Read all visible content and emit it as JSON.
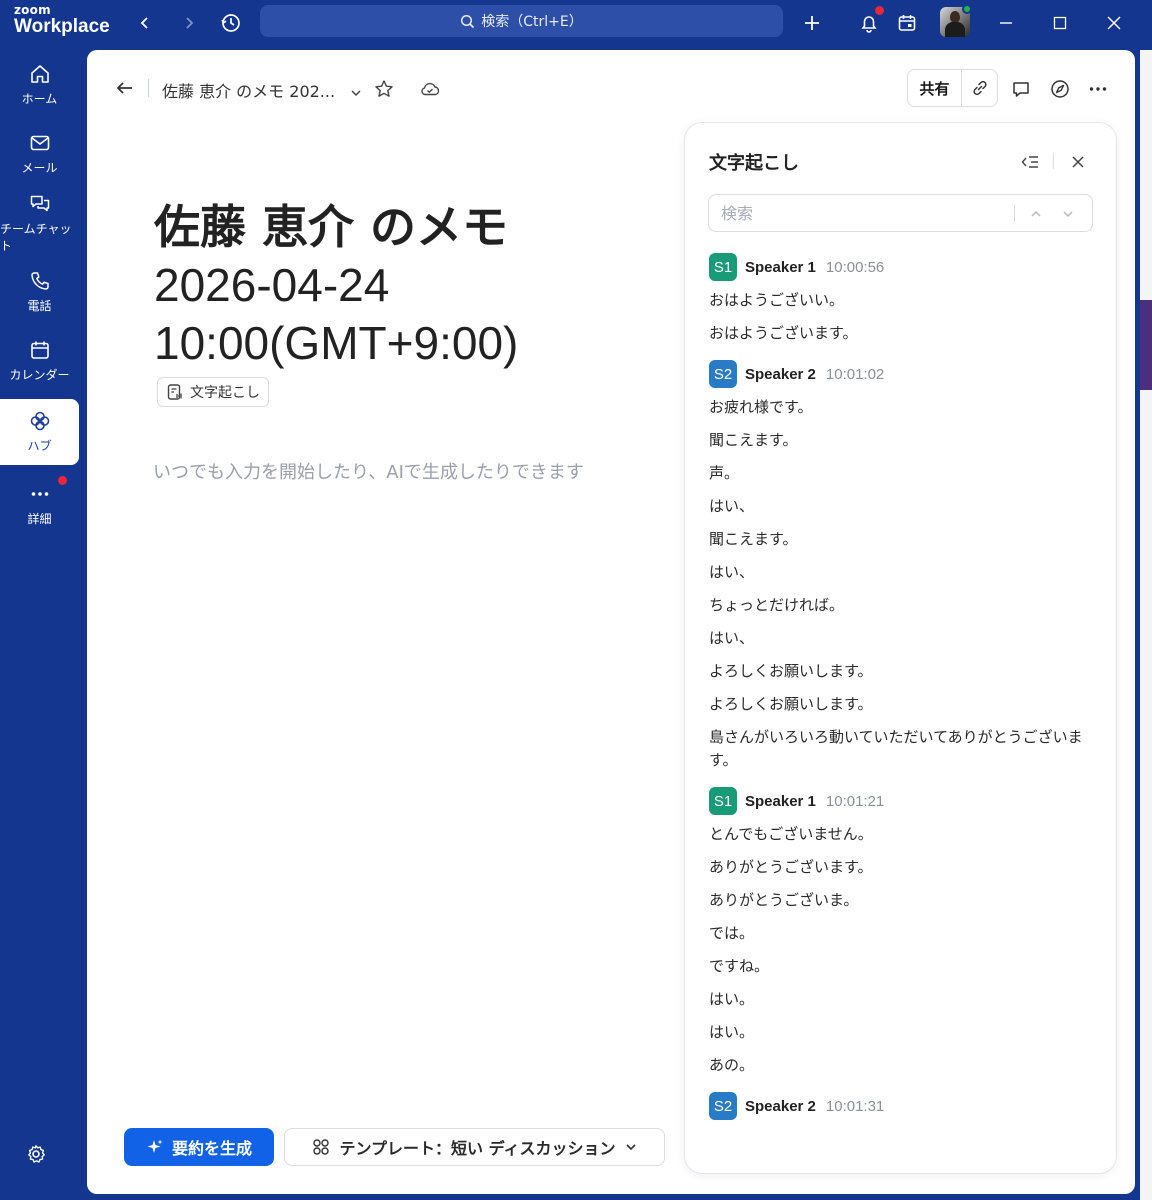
{
  "app": {
    "logo_small": "zoom",
    "logo_big": "Workplace",
    "search_placeholder": "検索（Ctrl+E）"
  },
  "colors": {
    "frame": "#14368f",
    "primary_button": "#1262e8",
    "speaker1": "#1a9b78",
    "speaker2": "#2a7bc6",
    "notification": "#e8273c",
    "online": "#22b14c"
  },
  "nav": {
    "items": [
      {
        "label": "ホーム",
        "icon": "home-icon"
      },
      {
        "label": "メール",
        "icon": "mail-icon"
      },
      {
        "label": "チームチャット",
        "icon": "chat-icon"
      },
      {
        "label": "電話",
        "icon": "phone-icon"
      },
      {
        "label": "カレンダー",
        "icon": "calendar-icon"
      },
      {
        "label": "ハブ",
        "icon": "hub-icon",
        "active": true
      },
      {
        "label": "詳細",
        "icon": "more-icon"
      }
    ]
  },
  "doc": {
    "breadcrumb_title": "佐藤 恵介 のメモ 202...",
    "share_label": "共有",
    "title_line1": "佐藤 恵介 のメモ",
    "title_line2": "2026-04-24",
    "title_line3": "10:00(GMT+9:00)",
    "chip_label": "文字起こし",
    "placeholder": "いつでも入力を開始したり、AIで生成したりできます",
    "generate_button": "要約を生成",
    "template_button": "テンプレート：短い ディスカッション"
  },
  "transcript": {
    "title": "文字起こし",
    "search_placeholder": "検索",
    "blocks": [
      {
        "badge": "S1",
        "speaker": "Speaker 1",
        "time": "10:00:56",
        "lines": [
          "おはようございい。",
          "おはようございます。"
        ]
      },
      {
        "badge": "S2",
        "speaker": "Speaker 2",
        "time": "10:01:02",
        "lines": [
          "お疲れ様です。",
          "聞こえます。",
          "声。",
          "はい、",
          "聞こえます。",
          "はい、",
          "ちょっとだければ。",
          "はい、",
          "よろしくお願いします。",
          "よろしくお願いします。",
          "島さんがいろいろ動いていただいてありがとうございます。"
        ]
      },
      {
        "badge": "S1",
        "speaker": "Speaker 1",
        "time": "10:01:21",
        "lines": [
          "とんでもございません。",
          "ありがとうございます。",
          "ありがとうございま。",
          "では。",
          "ですね。",
          "はい。",
          "はい。",
          "あの。"
        ]
      },
      {
        "badge": "S2",
        "speaker": "Speaker 2",
        "time": "10:01:31",
        "lines": []
      }
    ]
  }
}
